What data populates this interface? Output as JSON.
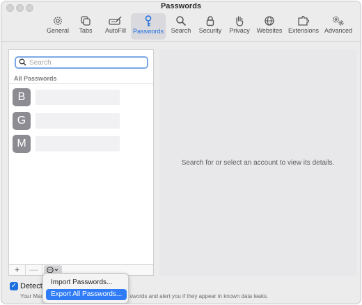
{
  "window": {
    "title": "Passwords"
  },
  "toolbar": {
    "items": [
      {
        "label": "General",
        "icon": "gear-icon"
      },
      {
        "label": "Tabs",
        "icon": "tabs-icon"
      },
      {
        "label": "AutoFill",
        "icon": "autofill-icon"
      },
      {
        "label": "Passwords",
        "icon": "key-icon",
        "active": true
      },
      {
        "label": "Search",
        "icon": "search-icon"
      },
      {
        "label": "Security",
        "icon": "lock-icon"
      },
      {
        "label": "Privacy",
        "icon": "hand-icon"
      },
      {
        "label": "Websites",
        "icon": "globe-icon"
      },
      {
        "label": "Extensions",
        "icon": "puzzle-icon"
      },
      {
        "label": "Advanced",
        "icon": "gears-icon"
      }
    ],
    "active_color": "#1f6fe0"
  },
  "sidebar": {
    "search_placeholder": "Search",
    "section_label": "All Passwords",
    "entries": [
      {
        "initial": "B"
      },
      {
        "initial": "G"
      },
      {
        "initial": "M"
      }
    ],
    "footer": {
      "add": "+",
      "remove": "—",
      "more": "⊖⌄"
    }
  },
  "detail": {
    "message": "Search for or select an account to view its details."
  },
  "detect": {
    "label": "Detect c",
    "checked": true,
    "desc_left": "Your Mac",
    "desc_right": "swords and alert you if they appear in known data leaks."
  },
  "menu": {
    "items": [
      {
        "label": "Import Passwords..."
      },
      {
        "label": "Export All Passwords...",
        "highlighted": true
      }
    ]
  }
}
